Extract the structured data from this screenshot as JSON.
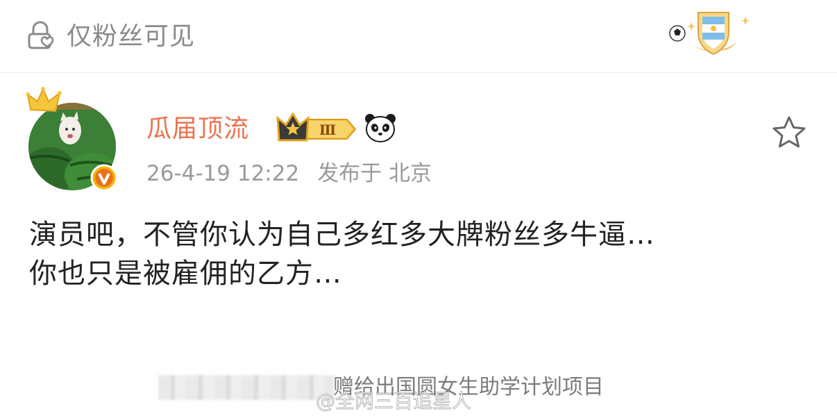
{
  "visibility": {
    "label": "仅粉丝可见",
    "icon": "lock-heart-icon"
  },
  "header_badge": {
    "icon": "argentina-football-shield-icon"
  },
  "post": {
    "author": {
      "name": "瓜届顶流",
      "level_badge": "Ⅲ",
      "name_color": "#eb7350"
    },
    "timestamp": "26-4-19 12:22",
    "location": "发布于 北京",
    "text_lines": [
      "演员吧，不管你认为自己多红多大牌粉丝多牛逼…",
      "你也只是被雇佣的乙方…"
    ]
  },
  "watermark": {
    "text": "赠给出国圆女生助学计划项目",
    "handle": "@全网三百追星人"
  },
  "colors": {
    "accent": "#eb7350",
    "muted": "#9a9a9a",
    "text": "#222222"
  }
}
